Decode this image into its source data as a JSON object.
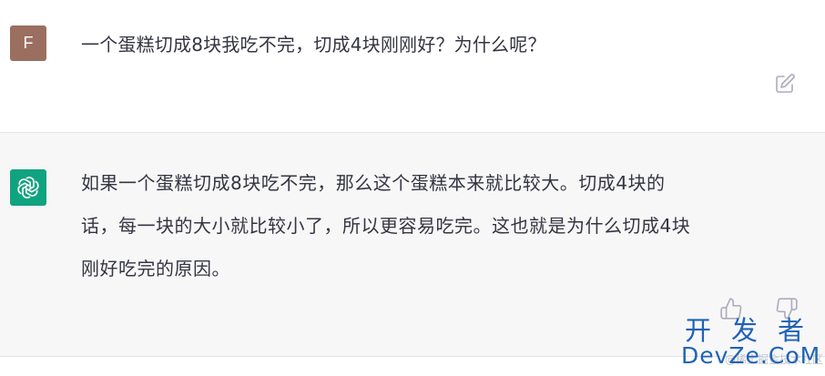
{
  "user_message": {
    "avatar_letter": "F",
    "avatar_color": "#9b6f5f",
    "text": "一个蛋糕切成8块我吃不完，切成4块刚刚好？为什么呢？",
    "edit_icon": "edit-icon"
  },
  "assistant_message": {
    "avatar_icon": "openai-logo-icon",
    "avatar_color": "#10a37f",
    "lines": [
      "如果一个蛋糕切成8块吃不完，那么这个蛋糕本来就比较大。切成4块的",
      "话，每一块的大小就比较小了，所以更容易吃完。这也就是为什么切成4块",
      "刚好吃完的原因。"
    ],
    "thumbs_up_icon": "thumbs-up-icon",
    "thumbs_down_icon": "thumbs-down-icon"
  },
  "watermark": {
    "line1": "开发者",
    "line2": "DevZe.CoM",
    "faint": "@稀土掘金技术社区"
  },
  "colors": {
    "text": "#343541",
    "assistant_bg": "#f7f7f8",
    "watermark": "#1f63b6"
  }
}
